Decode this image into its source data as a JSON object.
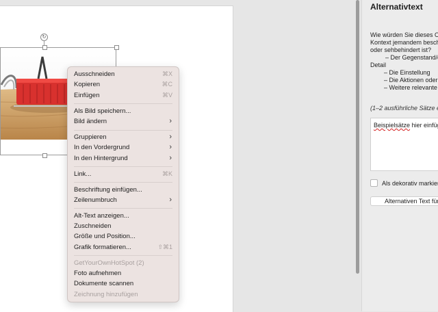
{
  "menu": {
    "groups": [
      {
        "items": [
          {
            "label": "Ausschneiden",
            "shortcut": "⌘X"
          },
          {
            "label": "Kopieren",
            "shortcut": "⌘C"
          },
          {
            "label": "Einfügen",
            "shortcut": "⌘V"
          }
        ]
      },
      {
        "items": [
          {
            "label": "Als Bild speichern..."
          },
          {
            "label": "Bild ändern",
            "submenu": true
          }
        ]
      },
      {
        "items": [
          {
            "label": "Gruppieren",
            "submenu": true
          },
          {
            "label": "In den Vordergrund",
            "submenu": true
          },
          {
            "label": "In den Hintergrund",
            "submenu": true
          }
        ]
      },
      {
        "items": [
          {
            "label": "Link...",
            "shortcut": "⌘K"
          }
        ]
      },
      {
        "items": [
          {
            "label": "Beschriftung einfügen..."
          },
          {
            "label": "Zeilenumbruch",
            "submenu": true
          }
        ]
      },
      {
        "items": [
          {
            "label": "Alt-Text anzeigen..."
          },
          {
            "label": "Zuschneiden"
          },
          {
            "label": "Größe und Position..."
          },
          {
            "label": "Grafik formatieren...",
            "shortcut": "⇧⌘1"
          }
        ]
      },
      {
        "items": [
          {
            "label": "GetYourOwnHotSpot (2)",
            "disabled": true
          },
          {
            "label": "Foto aufnehmen"
          },
          {
            "label": "Dokumente scannen"
          },
          {
            "label": "Zeichnung hinzufügen",
            "disabled": true
          }
        ]
      }
    ]
  },
  "pane": {
    "title": "Alternativtext",
    "desc_lines": [
      "Wie würden Sie dieses Ob",
      "Kontext jemandem besch",
      "oder sehbehindert ist?",
      "– Der Gegenstand/di",
      "Detail",
      "– Die Einstellung",
      "– Die Aktionen oder",
      "– Weitere relevante I"
    ],
    "hint": "(1–2 ausführliche Sätze e",
    "textarea_spell": "Beispielsätze",
    "textarea_rest": " hier einfüge",
    "checkbox_label": "Als dekorativ markiere",
    "button_label": "Alternativen Text für",
    "chevron_glyph": "›"
  },
  "colors": {
    "basket_red": "#d8312e",
    "wood": "#c99a5e"
  }
}
